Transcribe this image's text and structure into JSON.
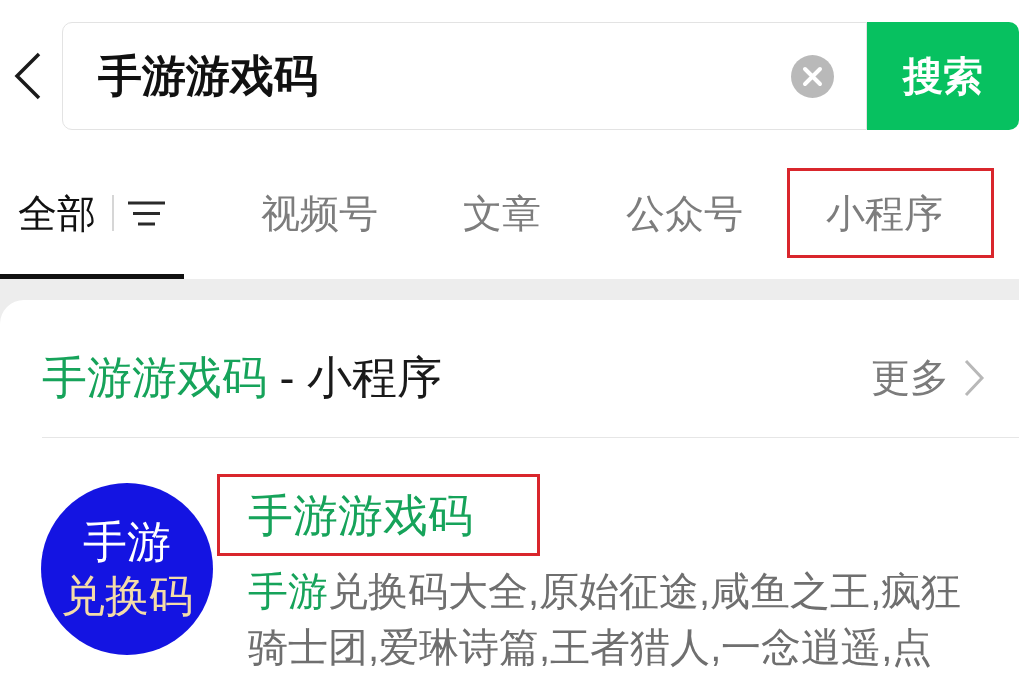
{
  "search": {
    "value": "手游游戏码",
    "button": "搜索"
  },
  "tabs": [
    {
      "label": "全部",
      "selected": true,
      "highlighted": false
    },
    {
      "label": "视频号",
      "selected": false,
      "highlighted": false
    },
    {
      "label": "文章",
      "selected": false,
      "highlighted": false
    },
    {
      "label": "公众号",
      "selected": false,
      "highlighted": false
    },
    {
      "label": "小程序",
      "selected": false,
      "highlighted": true
    }
  ],
  "section": {
    "title_segments": [
      {
        "text": "手游游戏码",
        "match": true
      },
      {
        "text": " - 小程序",
        "match": false
      }
    ],
    "more": "更多"
  },
  "results": [
    {
      "avatar_lines": [
        {
          "text": "手游",
          "color": "#ffffff"
        },
        {
          "text": "兑换码",
          "color": "#f4dca8"
        }
      ],
      "title_segments": [
        {
          "text": "手游游戏码",
          "match": true
        }
      ],
      "highlighted": true,
      "description_lines": [
        [
          {
            "text": "手游",
            "match": true
          },
          {
            "text": "兑换码大全,原始征途,咸鱼之王,疯狂",
            "match": false
          }
        ],
        [
          {
            "text": "骑士团,爱琳诗篇,王者猎人,一念逍遥,点",
            "match": false
          }
        ]
      ]
    }
  ]
}
